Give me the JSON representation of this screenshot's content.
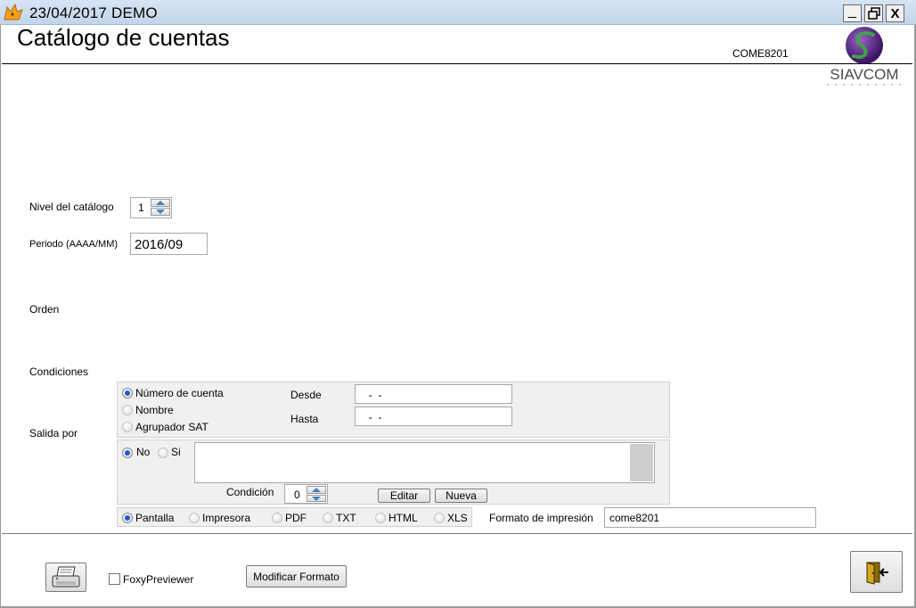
{
  "window": {
    "title": "23/04/2017  DEMO",
    "controls": {
      "minimize": "_",
      "close": "X"
    }
  },
  "header": {
    "title": "Catálogo de cuentas",
    "form_code": "COME8201",
    "logo_text": "SIAVCOM"
  },
  "form": {
    "nivel_label": "Nivel del catálogo",
    "nivel_value": "1",
    "periodo_label": "Periodo (AAAA/MM)",
    "periodo_value": "2016/09",
    "orden_label": "Orden",
    "condiciones_label": "Condiciones",
    "salida_label": "Salida por"
  },
  "orden_panel": {
    "options": [
      "Número de cuenta",
      "Nombre",
      "Agrupador SAT"
    ],
    "selected": "Número de cuenta",
    "desde_label": "Desde",
    "desde_value": "  -  -",
    "hasta_label": "Hasta",
    "hasta_value": "  -  -"
  },
  "condiciones_panel": {
    "no_label": "No",
    "si_label": "Si",
    "selected": "No",
    "condicion_label": "Condición",
    "condicion_value": "0",
    "editar_label": "Editar",
    "nueva_label": "Nueva"
  },
  "salida_panel": {
    "options": [
      "Pantalla",
      "Impresora",
      "PDF",
      "TXT",
      "HTML",
      "XLS"
    ],
    "selected": "Pantalla",
    "formato_label": "Formato de impresión",
    "formato_value": "come8201"
  },
  "footer": {
    "foxy_label": "FoxyPreviewer",
    "foxy_checked": false,
    "modificar_label": "Modificar Formato"
  },
  "colors": {
    "titlebar": "#c9d9ec",
    "panel": "#f0f0f0",
    "radio_selected": "#1c5ec9",
    "logo_purple": "#5b2a86",
    "logo_green": "#2f8a3a"
  }
}
